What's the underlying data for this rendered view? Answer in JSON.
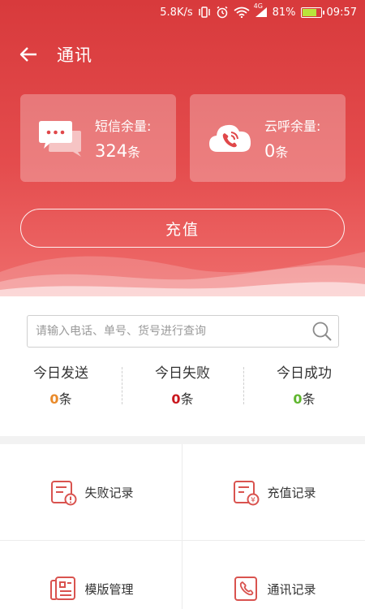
{
  "status_bar": {
    "net_speed": "5.8K/s",
    "network_type": "4G",
    "battery_percent": "81%",
    "battery_level": 0.81,
    "time": "09:57",
    "icons": [
      "vibrate-icon",
      "alarm-icon",
      "wifi-icon",
      "signal-icon",
      "battery-icon"
    ]
  },
  "header": {
    "title": "通讯",
    "back_icon": "arrow-left-icon"
  },
  "balances": {
    "sms": {
      "label": "短信余量:",
      "value": "324",
      "unit": "条",
      "icon": "sms-chat-icon"
    },
    "cloud_call": {
      "label": "云呼余量:",
      "value": "0",
      "unit": "条",
      "icon": "cloud-phone-icon"
    }
  },
  "recharge_button": {
    "label": "充值"
  },
  "search": {
    "placeholder": "请输入电话、单号、货号进行查询",
    "value": "",
    "icon": "search-icon"
  },
  "today_stats": [
    {
      "label": "今日发送",
      "value": "0",
      "unit": "条",
      "color": "#e98a2a"
    },
    {
      "label": "今日失败",
      "value": "0",
      "unit": "条",
      "color": "#c9171e"
    },
    {
      "label": "今日成功",
      "value": "0",
      "unit": "条",
      "color": "#5fb62e"
    }
  ],
  "menu": [
    {
      "label": "失败记录",
      "icon": "failure-record-icon"
    },
    {
      "label": "充值记录",
      "icon": "recharge-record-icon"
    },
    {
      "label": "模版管理",
      "icon": "template-manage-icon"
    },
    {
      "label": "通讯记录",
      "icon": "call-record-icon"
    }
  ],
  "colors": {
    "primary_red": "#e0484a",
    "icon_red": "#d9534f"
  }
}
